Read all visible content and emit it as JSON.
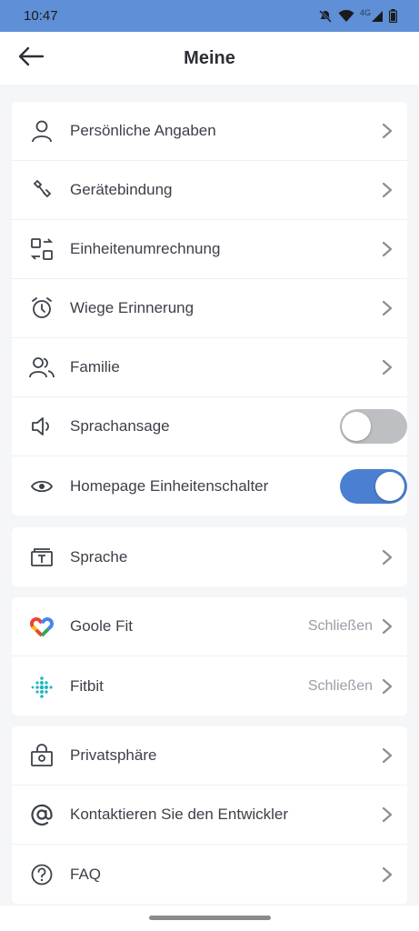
{
  "status": {
    "time": "10:47",
    "network": "4G"
  },
  "header": {
    "title": "Meine"
  },
  "group1": {
    "items": [
      {
        "label": "Persönliche Angaben"
      },
      {
        "label": "Gerätebindung"
      },
      {
        "label": "Einheitenumrechnung"
      },
      {
        "label": "Wiege Erinnerung"
      },
      {
        "label": "Familie"
      },
      {
        "label": "Sprachansage",
        "toggle": false
      },
      {
        "label": "Homepage Einheitenschalter",
        "toggle": true
      }
    ]
  },
  "group2": {
    "items": [
      {
        "label": "Sprache"
      }
    ]
  },
  "group3": {
    "items": [
      {
        "label": "Goole Fit",
        "value": "Schließen"
      },
      {
        "label": "Fitbit",
        "value": "Schließen"
      }
    ]
  },
  "group4": {
    "items": [
      {
        "label": "Privatsphäre"
      },
      {
        "label": "Kontaktieren Sie den Entwickler"
      },
      {
        "label": "FAQ"
      }
    ]
  },
  "colors": {
    "accent": "#4a7fd1",
    "status_bar": "#5f8fd6",
    "toggle_off": "#bdbfc3"
  }
}
